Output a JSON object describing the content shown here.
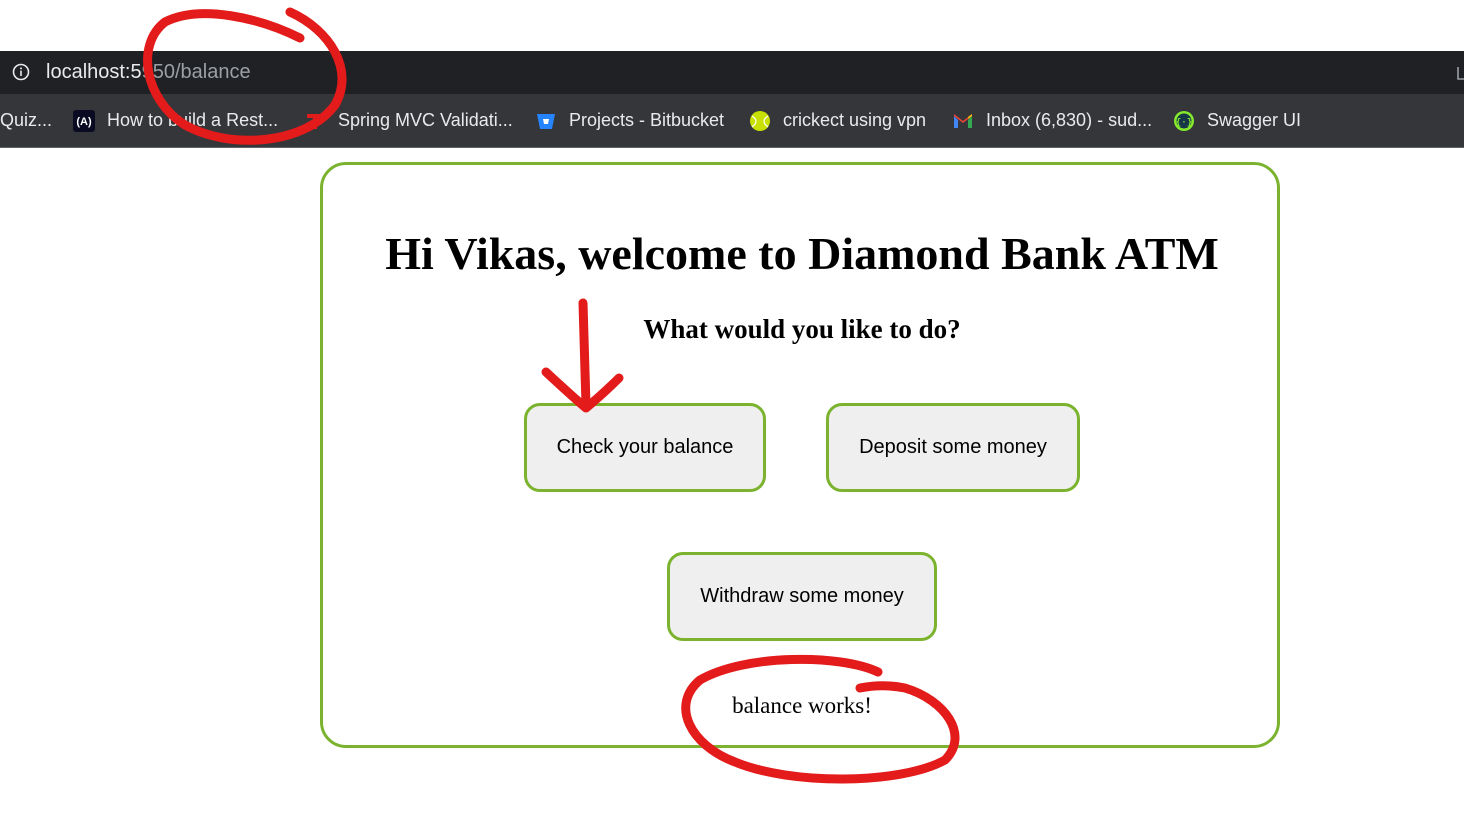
{
  "browser": {
    "url_host": "localhost:5",
    "url_rest": "950/balance",
    "bookmarks": [
      {
        "label": "Quiz...",
        "icon": "none"
      },
      {
        "label": "How to build a Rest...",
        "icon": "freecodecamp-icon"
      },
      {
        "label": "Spring MVC Validati...",
        "icon": "t-logo-icon"
      },
      {
        "label": "Projects - Bitbucket",
        "icon": "bitbucket-icon"
      },
      {
        "label": "crickect using vpn",
        "icon": "tennis-ball-icon"
      },
      {
        "label": "Inbox (6,830) - sud...",
        "icon": "gmail-icon"
      },
      {
        "label": "Swagger UI",
        "icon": "swagger-icon"
      }
    ]
  },
  "atm": {
    "title": "Hi Vikas, welcome to Diamond Bank ATM",
    "subtitle": "What would you like to do?",
    "buttons": {
      "balance": "Check your balance",
      "deposit": "Deposit some money",
      "withdraw": "Withdraw some money"
    },
    "output": "balance works!"
  },
  "colors": {
    "accent": "#7bb32e",
    "annotation": "#e31b1b",
    "toolbar": "#202124",
    "bookmarks_bar": "#35363a"
  }
}
